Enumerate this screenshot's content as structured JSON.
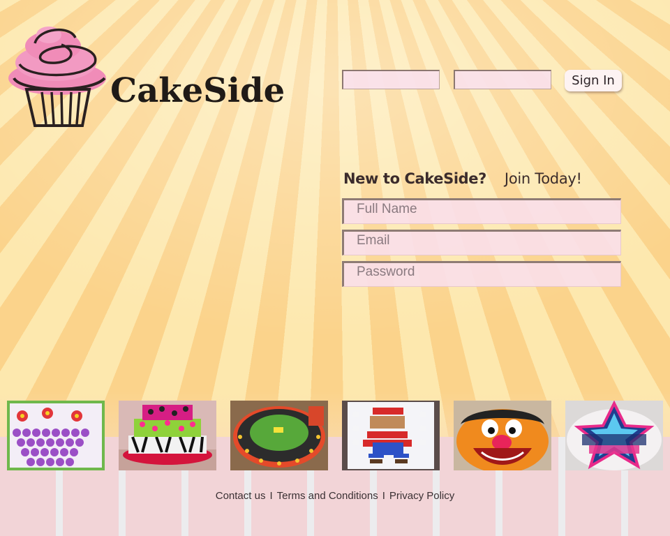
{
  "brand": {
    "name": "CakeSide",
    "logo_icon": "cupcake-icon"
  },
  "header": {
    "login_username_value": "",
    "login_password_value": "",
    "sign_in_label": "Sign In"
  },
  "registration": {
    "question": "New to CakeSide?",
    "cta": "Join Today!",
    "full_name_placeholder": "Full Name",
    "email_placeholder": "Email",
    "password_placeholder": "Password"
  },
  "gallery": [
    {
      "name": "flower-cupcake-cake"
    },
    {
      "name": "zebra-tiered-cake"
    },
    {
      "name": "race-track-cake"
    },
    {
      "name": "mario-cupcake-cake"
    },
    {
      "name": "ernie-cake"
    },
    {
      "name": "star-cake"
    }
  ],
  "footer": {
    "contact": "Contact us",
    "terms": "Terms and Conditions",
    "privacy": "Privacy Policy",
    "separator": "I"
  },
  "colors": {
    "stripe_dark": "#fbd38b",
    "stripe_light": "#fde8ae",
    "field_bg": "#fadee8",
    "frosting_pink": "#f08cb8"
  }
}
